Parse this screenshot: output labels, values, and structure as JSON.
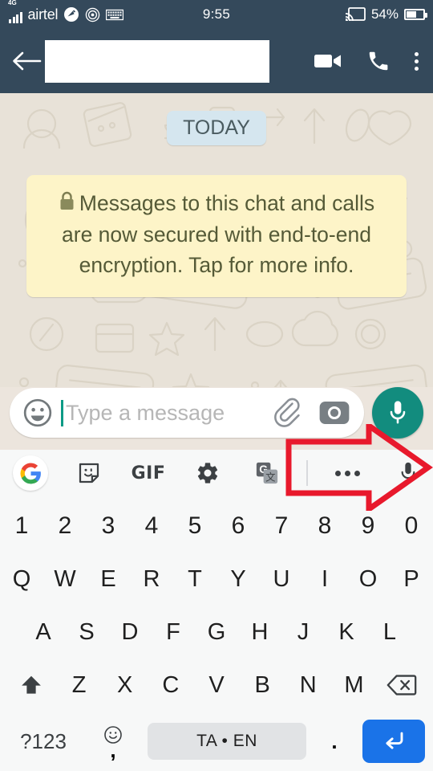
{
  "status_bar": {
    "network_type": "4G",
    "carrier": "airtel",
    "time": "9:55",
    "battery_percent": "54%",
    "icons": [
      "signal-bars-icon",
      "carrier-label",
      "do-not-disturb-icon",
      "nfc-icon",
      "keyboard-icon",
      "cast-icon",
      "battery-icon"
    ]
  },
  "app_bar": {
    "back_label": "back-arrow",
    "contact_name": "",
    "video_call_label": "Video call",
    "voice_call_label": "Voice call",
    "menu_label": "More options"
  },
  "chat": {
    "day_divider": "TODAY",
    "encryption_notice": "Messages to this chat and calls are now secured with end-to-end encryption. Tap for more info."
  },
  "input_bar": {
    "placeholder": "Type a message",
    "emoji_label": "Emoji",
    "attach_label": "Attach",
    "camera_label": "Camera",
    "mic_label": "Voice message"
  },
  "keyboard": {
    "toolbar": {
      "google_label": "G",
      "sticker_label": "Stickers",
      "gif_label": "GIF",
      "settings_label": "Settings",
      "translate_label": "Translate",
      "more_label": "More",
      "mic_label": "Voice input"
    },
    "rows": {
      "numbers": [
        "1",
        "2",
        "3",
        "4",
        "5",
        "6",
        "7",
        "8",
        "9",
        "0"
      ],
      "top": [
        "Q",
        "W",
        "E",
        "R",
        "T",
        "Y",
        "U",
        "I",
        "O",
        "P"
      ],
      "home": [
        "A",
        "S",
        "D",
        "F",
        "G",
        "H",
        "J",
        "K",
        "L"
      ],
      "bottom": [
        "Z",
        "X",
        "C",
        "V",
        "B",
        "N",
        "M"
      ],
      "shift_label": "Shift",
      "backspace_label": "Backspace"
    },
    "bottom_row": {
      "symbols_key": "?123",
      "comma_key": ",",
      "space_key": "TA • EN",
      "period_key": ".",
      "enter_key": "Enter"
    }
  },
  "annotation": {
    "type": "red-arrow",
    "direction": "right",
    "points_at": "keyboard-voice-input-icon",
    "color": "#e8192c"
  },
  "colors": {
    "header": "#34495b",
    "chat_background": "#e8e2d8",
    "encryption_bubble": "#fdf4c8",
    "day_chip": "#d5e6ef",
    "accent_teal": "#128c7e",
    "enter_blue": "#1a73e8",
    "keyboard_background": "#f7f8f8"
  }
}
